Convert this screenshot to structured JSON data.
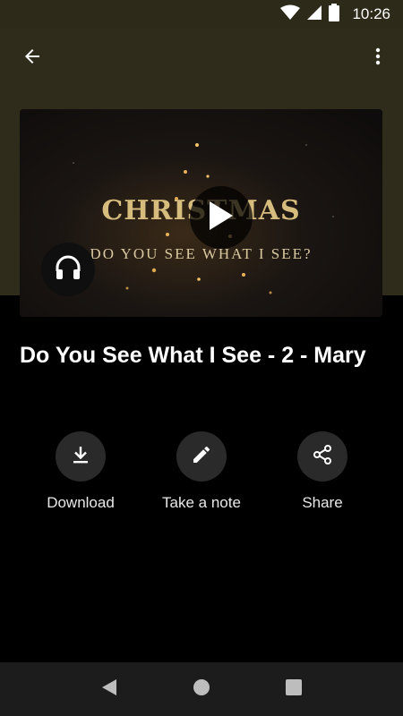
{
  "status_bar": {
    "time": "10:26",
    "icons": [
      "wifi-icon",
      "signal-icon",
      "battery-icon"
    ]
  },
  "app_bar": {
    "back_icon": "arrow-back-icon",
    "menu_icon": "more-vert-icon"
  },
  "thumbnail": {
    "title_text": "CHRISTMAS",
    "subtitle_text": "DO YOU SEE WHAT I SEE?",
    "play_icon": "play-icon",
    "audio_icon": "headphones-icon"
  },
  "episode": {
    "title": "Do You See What I See - 2 - Mary"
  },
  "actions": [
    {
      "label": "Download",
      "icon": "download-icon"
    },
    {
      "label": "Take a note",
      "icon": "pencil-icon"
    },
    {
      "label": "Share",
      "icon": "share-icon"
    }
  ],
  "nav_bar": {
    "icons": [
      "back-triangle-icon",
      "home-circle-icon",
      "recents-square-icon"
    ]
  },
  "colors": {
    "header_band": "#2f2c1c",
    "status_bar": "#2d2a1a",
    "action_circle": "#2a2a2a",
    "background": "#000000"
  }
}
